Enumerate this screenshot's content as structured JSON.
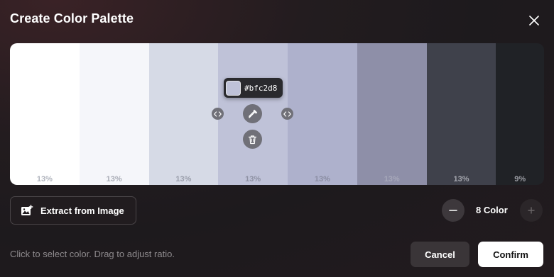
{
  "dialog": {
    "title": "Create Color Palette"
  },
  "palette": {
    "swatches": [
      {
        "color": "#ffffff",
        "ratio": "13%",
        "label_color": "#b0b4bd"
      },
      {
        "color": "#f5f6fa",
        "ratio": "13%",
        "label_color": "#a9acb6"
      },
      {
        "color": "#d6dae6",
        "ratio": "13%",
        "label_color": "#9a9eab"
      },
      {
        "color": "#bfc2d8",
        "ratio": "13%",
        "label_color": "#8e91a3"
      },
      {
        "color": "#aeb1cc",
        "ratio": "13%",
        "label_color": "#8a8da2"
      },
      {
        "color": "#8e8fa8",
        "ratio": "13%",
        "label_color": "#a7a8ba"
      },
      {
        "color": "#3f414b",
        "ratio": "13%",
        "label_color": "#a3a5ad"
      },
      {
        "color": "#202226",
        "ratio": "9%",
        "label_color": "#9a9ca3"
      }
    ],
    "selected": {
      "hex": "#bfc2d8"
    }
  },
  "actions": {
    "extract_label": "Extract from Image",
    "count_label": "8 Color",
    "hint": "Click to select color. Drag to adjust ratio.",
    "cancel_label": "Cancel",
    "confirm_label": "Confirm"
  },
  "icons": {
    "close": "close-icon",
    "image": "image-plus-icon",
    "eyedropper": "eyedropper-icon",
    "trash": "trash-icon",
    "resize": "resize-handle-icon",
    "minus": "minus-icon",
    "plus": "plus-icon"
  }
}
